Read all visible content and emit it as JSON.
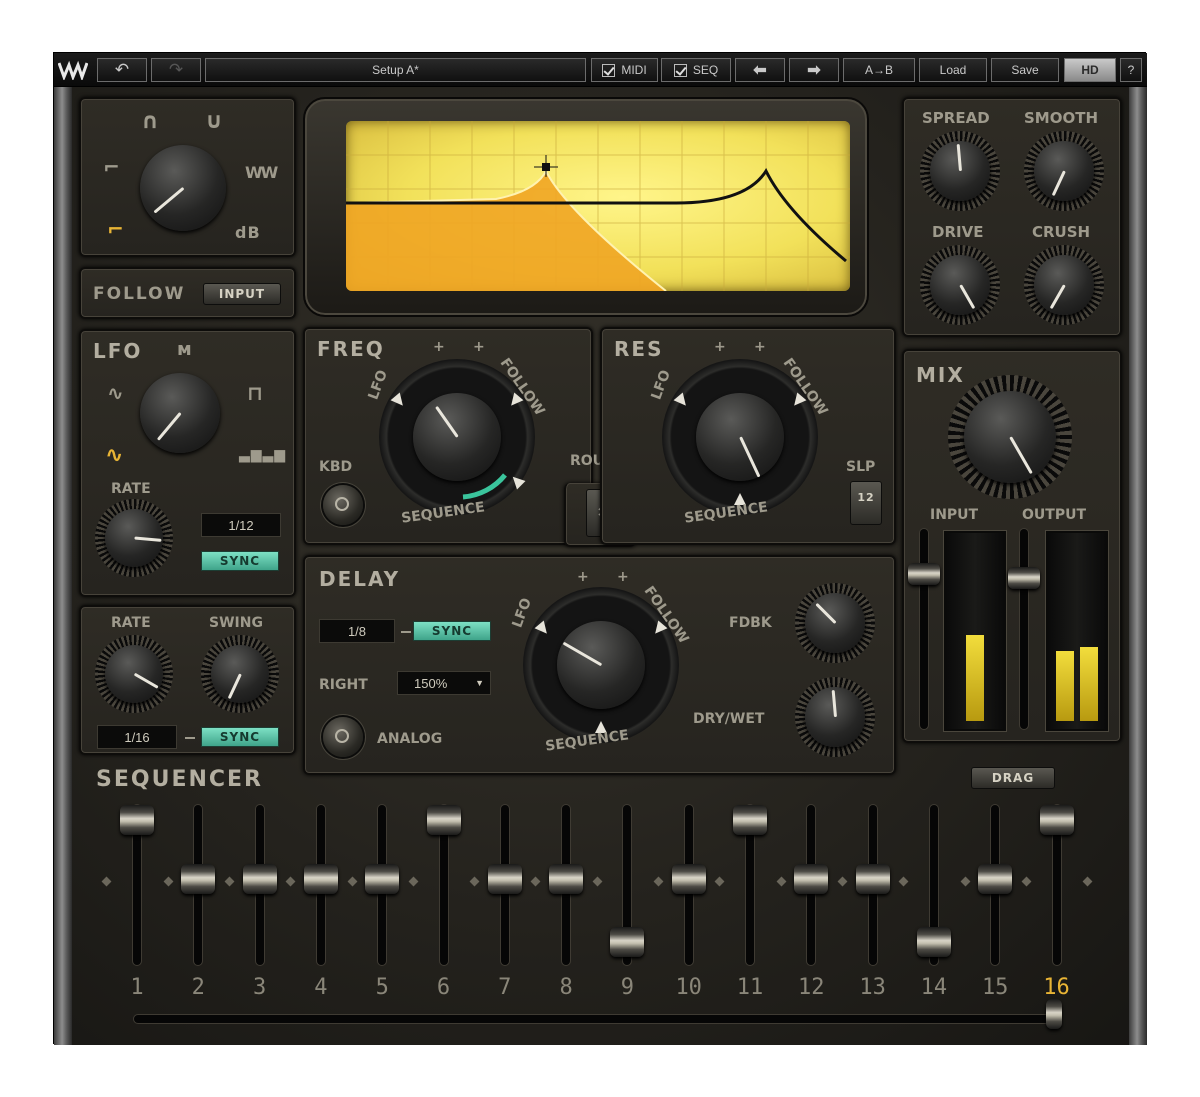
{
  "toolbar": {
    "preset": "Setup A*",
    "midi_label": "MIDI",
    "seq_label": "SEQ",
    "ab_label": "A→B",
    "load_label": "Load",
    "save_label": "Save",
    "hd_label": "HD",
    "help_label": "?"
  },
  "filter_type": {
    "db_label": "dB"
  },
  "follow": {
    "label": "FOLLOW",
    "mode": "INPUT"
  },
  "lfo": {
    "label": "LFO",
    "rate_label": "RATE",
    "rate_value": "1/12",
    "sync_label": "SYNC"
  },
  "sequencer_ctrl": {
    "rate_label": "RATE",
    "swing_label": "SWING",
    "rate_value": "1/16",
    "sync_label": "SYNC"
  },
  "freq": {
    "label": "FREQ",
    "kbd_label": "KBD",
    "lfo": "LFO",
    "follow": "FOLLOW",
    "sequence": "SEQUENCE"
  },
  "res": {
    "label": "RES",
    "slp_label": "SLP",
    "slp_value": "12",
    "lfo": "LFO",
    "follow": "FOLLOW",
    "sequence": "SEQUENCE"
  },
  "route": {
    "label": "ROUTE"
  },
  "delay": {
    "label": "DELAY",
    "time_value": "1/8",
    "sync_label": "SYNC",
    "right_label": "RIGHT",
    "right_value": "150%",
    "analog_label": "ANALOG",
    "fdbk_label": "FDBK",
    "drywet_label": "DRY/WET",
    "lfo": "LFO",
    "follow": "FOLLOW",
    "sequence": "SEQUENCE"
  },
  "dist": {
    "spread_label": "SPREAD",
    "smooth_label": "SMOOTH",
    "drive_label": "DRIVE",
    "crush_label": "CRUSH"
  },
  "mix": {
    "label": "MIX",
    "input_label": "INPUT",
    "output_label": "OUTPUT",
    "input_level": 0.47,
    "output_level_l": 0.38,
    "output_level_r": 0.4
  },
  "sequencer": {
    "label": "SEQUENCER",
    "drag_label": "DRAG",
    "active_step": 16,
    "steps": [
      {
        "n": "1",
        "level": 1.0
      },
      {
        "n": "2",
        "level": 0.52
      },
      {
        "n": "3",
        "level": 0.52
      },
      {
        "n": "4",
        "level": 0.52
      },
      {
        "n": "5",
        "level": 0.52
      },
      {
        "n": "6",
        "level": 1.0
      },
      {
        "n": "7",
        "level": 0.52
      },
      {
        "n": "8",
        "level": 0.52
      },
      {
        "n": "9",
        "level": 0.0
      },
      {
        "n": "10",
        "level": 0.52
      },
      {
        "n": "11",
        "level": 1.0
      },
      {
        "n": "12",
        "level": 0.52
      },
      {
        "n": "13",
        "level": 0.52
      },
      {
        "n": "14",
        "level": 0.0
      },
      {
        "n": "15",
        "level": 0.52
      },
      {
        "n": "16",
        "level": 1.0
      }
    ]
  },
  "colors": {
    "screen": "#f2e15a",
    "sync": "#5ec4a8",
    "meter": "#e8d02c",
    "active_step": "#e8b435"
  }
}
